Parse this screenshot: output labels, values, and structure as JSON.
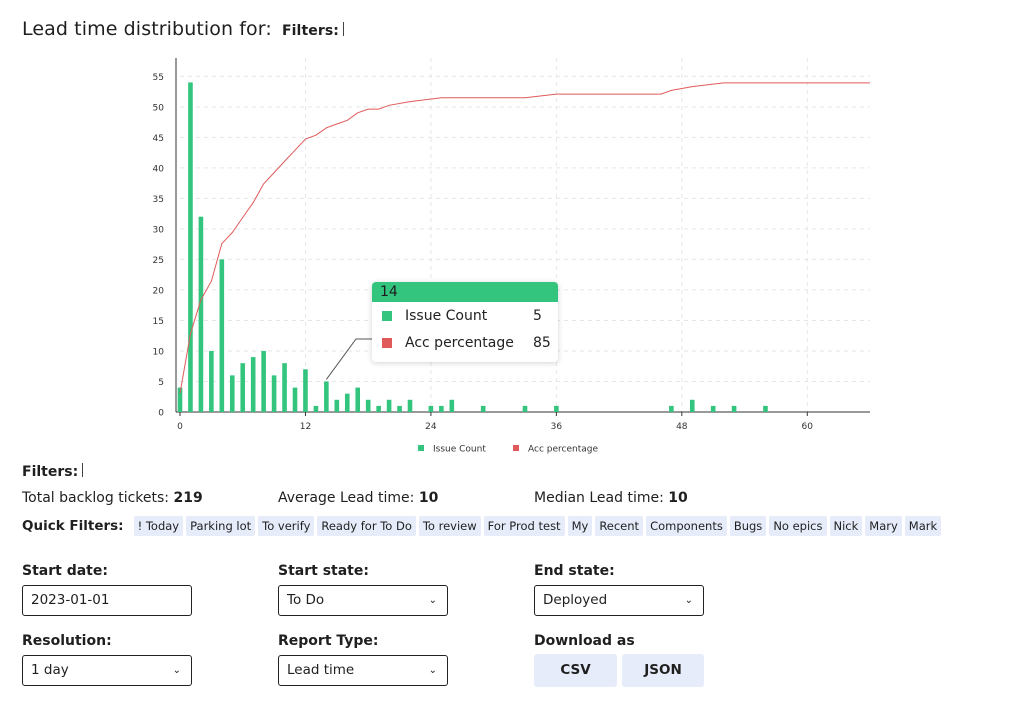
{
  "header": {
    "title": "Lead time distribution for:",
    "filters_label": "Filters:"
  },
  "chart_data": {
    "type": "bar",
    "title": "",
    "x": [
      0,
      1,
      2,
      3,
      4,
      5,
      6,
      7,
      8,
      9,
      10,
      11,
      12,
      13,
      14,
      15,
      16,
      17,
      18,
      19,
      20,
      21,
      22,
      24,
      25,
      26,
      29,
      33,
      36,
      47,
      49,
      51,
      53,
      56
    ],
    "series": [
      {
        "name": "Issue Count",
        "type": "bar",
        "color": "#33c47e",
        "values": [
          4,
          54,
          32,
          10,
          25,
          6,
          8,
          9,
          10,
          6,
          8,
          4,
          7,
          1,
          5,
          2,
          3,
          4,
          2,
          1,
          2,
          1,
          2,
          1,
          1,
          2,
          1,
          1,
          1,
          1,
          2,
          1,
          1,
          1
        ]
      },
      {
        "name": "Acc percentage",
        "type": "line",
        "color": "#e05a5a",
        "line": [
          [
            0,
            5
          ],
          [
            1,
            21
          ],
          [
            2,
            30
          ],
          [
            3,
            35
          ],
          [
            4,
            45
          ],
          [
            5,
            48
          ],
          [
            6,
            52
          ],
          [
            7,
            56
          ],
          [
            8,
            61
          ],
          [
            9,
            64
          ],
          [
            10,
            67
          ],
          [
            11,
            70
          ],
          [
            12,
            73
          ],
          [
            13,
            74
          ],
          [
            14,
            76
          ],
          [
            15,
            77
          ],
          [
            16,
            78
          ],
          [
            17,
            80
          ],
          [
            18,
            81
          ],
          [
            19,
            81
          ],
          [
            20,
            82
          ],
          [
            22,
            83
          ],
          [
            25,
            84
          ],
          [
            29,
            84
          ],
          [
            33,
            84
          ],
          [
            36,
            85
          ],
          [
            46,
            85
          ],
          [
            47,
            86
          ],
          [
            49,
            87
          ],
          [
            52,
            88
          ],
          [
            53,
            88
          ],
          [
            66,
            88
          ]
        ]
      }
    ],
    "xticks": [
      0,
      12,
      24,
      36,
      48,
      60
    ],
    "yticks": [
      0,
      5,
      10,
      15,
      20,
      25,
      30,
      35,
      40,
      45,
      50,
      55
    ],
    "xlim": [
      0,
      66
    ],
    "ylim": [
      0,
      58
    ],
    "grid": true,
    "legend": "bottom-center"
  },
  "tooltip": {
    "header": "14",
    "rows": [
      {
        "label": "Issue Count",
        "value": "5",
        "color": "#33c47e"
      },
      {
        "label": "Acc percentage",
        "value": "85",
        "color": "#e05a5a"
      }
    ]
  },
  "filters_label": "Filters:",
  "stats": {
    "backlog_label": "Total backlog tickets:",
    "backlog_value": "219",
    "avg_label": "Average Lead time:",
    "avg_value": "10",
    "median_label": "Median Lead time:",
    "median_value": "10"
  },
  "quick_filters": {
    "label": "Quick Filters:",
    "items": [
      "! Today",
      "Parking lot",
      "To verify",
      "Ready for To Do",
      "To review",
      "For Prod test",
      "My",
      "Recent",
      "Components",
      "Bugs",
      "No epics",
      "Nick",
      "Mary",
      "Mark"
    ]
  },
  "form": {
    "start_date_label": "Start date:",
    "start_date_value": "2023-01-01",
    "start_state_label": "Start state:",
    "start_state_value": "To Do",
    "end_state_label": "End state:",
    "end_state_value": "Deployed",
    "resolution_label": "Resolution:",
    "resolution_value": "1 day",
    "report_type_label": "Report Type:",
    "report_type_value": "Lead time",
    "download_label": "Download as",
    "csv_label": "CSV",
    "json_label": "JSON"
  }
}
